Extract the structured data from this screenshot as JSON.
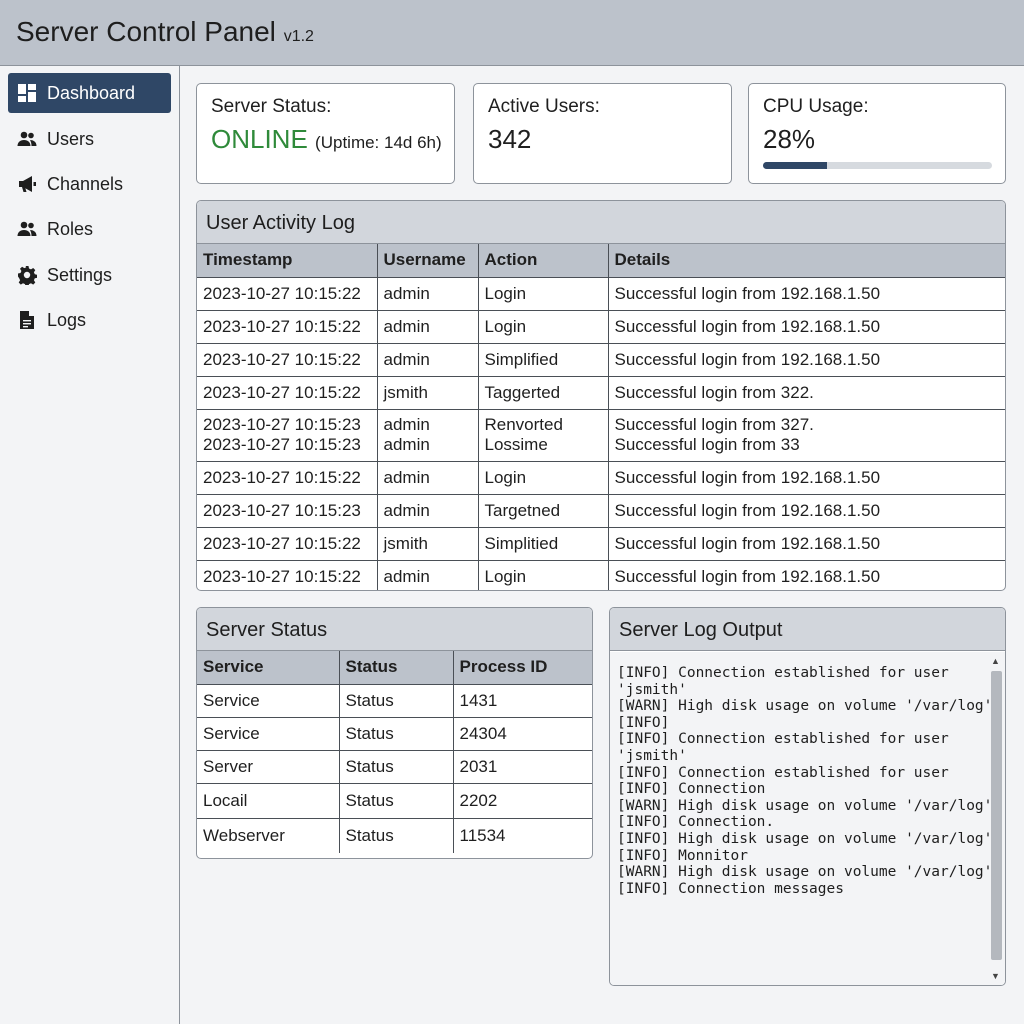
{
  "header": {
    "title": "Server Control Panel",
    "version": "v1.2"
  },
  "sidebar": {
    "items": [
      {
        "label": "Dashboard",
        "icon": "dashboard-icon",
        "active": true
      },
      {
        "label": "Users",
        "icon": "users-icon"
      },
      {
        "label": "Channels",
        "icon": "megaphone-icon"
      },
      {
        "label": "Roles",
        "icon": "users-icon"
      },
      {
        "label": "Settings",
        "icon": "gear-icon"
      },
      {
        "label": "Logs",
        "icon": "document-icon"
      }
    ]
  },
  "cards": {
    "server_status": {
      "label": "Server Status:",
      "value": "ONLINE",
      "uptime": "(Uptime: 14d 6h)",
      "value_color": "#2f8a3a"
    },
    "active_users": {
      "label": "Active Users:",
      "value": "342"
    },
    "cpu_usage": {
      "label": "CPU Usage:",
      "value": "28%",
      "percent": 28
    }
  },
  "activity_log": {
    "title": "User Activity Log",
    "columns": [
      "Timestamp",
      "Username",
      "Action",
      "Details"
    ],
    "rows": [
      [
        "2023-10-27 10:15:22",
        "admin",
        "Login",
        "Successful login from 192.168.1.50"
      ],
      [
        "2023-10-27 10:15:22",
        "admin",
        "Login",
        "Successful login from 192.168.1.50"
      ],
      [
        "2023-10-27 10:15:22",
        "admin",
        "Simplified",
        "Successful login from 192.168.1.50"
      ],
      [
        "2023-10-27 10:15:22",
        "jsmith",
        "Taggerted",
        "Successful login from 322."
      ],
      [
        "2023-10-27 10:15:23\n2023-10-27 10:15:23",
        "admin\nadmin",
        "Renvorted\nLossime",
        "Successful login from 327.\nSuccessful login from 33"
      ],
      [
        "2023-10-27 10:15:22",
        "admin",
        "Login",
        "Successful login from 192.168.1.50"
      ],
      [
        "2023-10-27 10:15:23",
        "admin",
        "Targetned",
        "Successful login from 192.168.1.50"
      ],
      [
        "2023-10-27 10:15:22",
        "jsmith",
        "Simplitied",
        "Successful login from 192.168.1.50"
      ],
      [
        "2023-10-27 10:15:22",
        "admin",
        "Login",
        "Successful login from 192.168.1.50"
      ]
    ]
  },
  "server_status_table": {
    "title": "Server Status",
    "columns": [
      "Service",
      "Status",
      "Process ID"
    ],
    "rows": [
      [
        "Service",
        "Status",
        "1431"
      ],
      [
        "Service",
        "Status",
        "24304"
      ],
      [
        "Server",
        "Status",
        "2031"
      ],
      [
        "Locail",
        "Status",
        "2202"
      ],
      [
        "Webserver",
        "Status",
        "11534"
      ]
    ]
  },
  "log_output": {
    "title": "Server Log Output",
    "lines": [
      "[INFO] Connection established for user",
      "'jsmith'",
      "[WARN] High disk usage on volume '/var/log'",
      "[INFO]",
      "[INFO] Connection established for user",
      "'jsmith'",
      "[INFO] Connection established for user",
      "[INFO] Connection",
      "[WARN] High disk usage on volume '/var/log'",
      "[INFO] Connection.",
      "[INFO] High disk usage on volume '/var/log'",
      "[INFO] Monnitor",
      "[WARN] High disk usage on volume '/var/log'",
      "[INFO] Connection messages"
    ]
  }
}
